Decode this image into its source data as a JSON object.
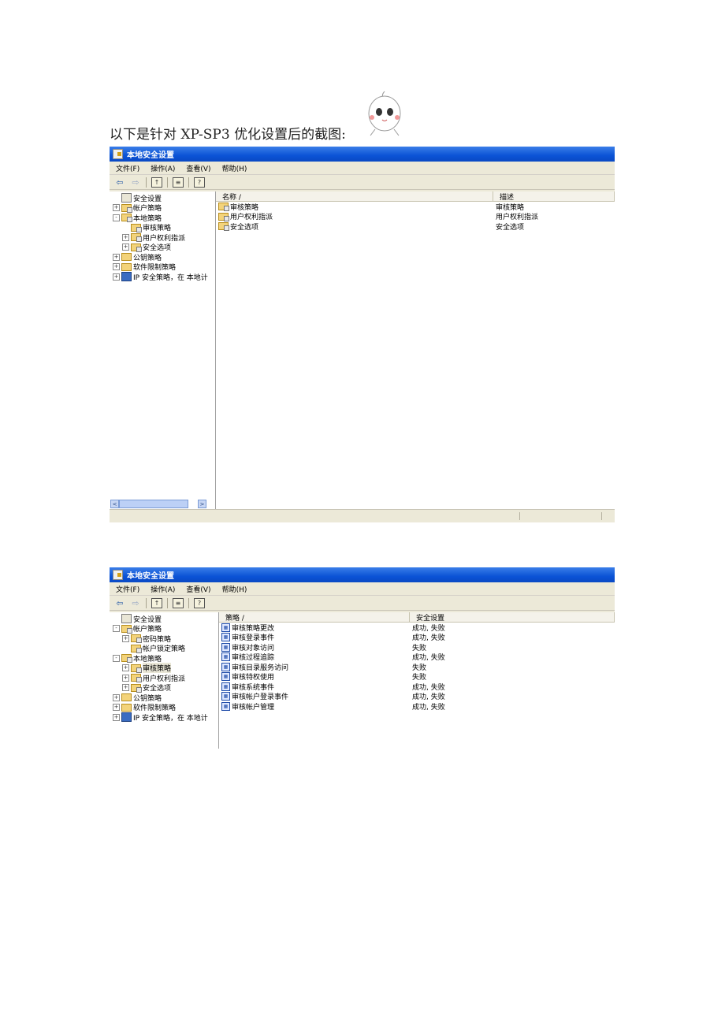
{
  "caption": "以下是针对 XP-SP3 优化设置后的截图:",
  "window": {
    "title": "本地安全设置",
    "menu": [
      "文件(F)",
      "操作(A)",
      "查看(V)",
      "帮助(H)"
    ]
  },
  "screen1": {
    "tree": [
      {
        "label": "安全设置",
        "level": 0,
        "exp": "",
        "icon": "root"
      },
      {
        "label": "帐户策略",
        "level": 0,
        "exp": "+",
        "icon": "folder"
      },
      {
        "label": "本地策略",
        "level": 0,
        "exp": "-",
        "icon": "folder"
      },
      {
        "label": "审核策略",
        "level": 1,
        "exp": "",
        "icon": "folder"
      },
      {
        "label": "用户权利指派",
        "level": 1,
        "exp": "+",
        "icon": "folder"
      },
      {
        "label": "安全选项",
        "level": 1,
        "exp": "+",
        "icon": "folder"
      },
      {
        "label": "公钥策略",
        "level": 0,
        "exp": "+",
        "icon": "plain"
      },
      {
        "label": "软件限制策略",
        "level": 0,
        "exp": "+",
        "icon": "plain"
      },
      {
        "label": "IP 安全策略，在 本地计",
        "level": 0,
        "exp": "+",
        "icon": "ip"
      }
    ],
    "columns": [
      "名称 /",
      "描述"
    ],
    "rows": [
      [
        "审核策略",
        "审核策略"
      ],
      [
        "用户权利指派",
        "用户权利指派"
      ],
      [
        "安全选项",
        "安全选项"
      ]
    ]
  },
  "screen2": {
    "tree": [
      {
        "label": "安全设置",
        "level": 0,
        "exp": "",
        "icon": "root"
      },
      {
        "label": "帐户策略",
        "level": 0,
        "exp": "-",
        "icon": "folder"
      },
      {
        "label": "密码策略",
        "level": 1,
        "exp": "+",
        "icon": "folder"
      },
      {
        "label": "帐户锁定策略",
        "level": 1,
        "exp": "",
        "icon": "folder"
      },
      {
        "label": "本地策略",
        "level": 0,
        "exp": "-",
        "icon": "folder"
      },
      {
        "label": "审核策略",
        "level": 1,
        "exp": "+",
        "icon": "folder",
        "selected": true
      },
      {
        "label": "用户权利指派",
        "level": 1,
        "exp": "+",
        "icon": "folder"
      },
      {
        "label": "安全选项",
        "level": 1,
        "exp": "+",
        "icon": "folder"
      },
      {
        "label": "公钥策略",
        "level": 0,
        "exp": "+",
        "icon": "plain"
      },
      {
        "label": "软件限制策略",
        "level": 0,
        "exp": "+",
        "icon": "plain"
      },
      {
        "label": "IP 安全策略，在 本地计",
        "level": 0,
        "exp": "+",
        "icon": "ip"
      }
    ],
    "columns": [
      "策略 /",
      "安全设置"
    ],
    "rows": [
      [
        "审核策略更改",
        "成功, 失败"
      ],
      [
        "审核登录事件",
        "成功, 失败"
      ],
      [
        "审核对象访问",
        "失败"
      ],
      [
        "审核过程追踪",
        "成功, 失败"
      ],
      [
        "审核目录服务访问",
        "失败"
      ],
      [
        "审核特权使用",
        "失败"
      ],
      [
        "审核系统事件",
        "成功, 失败"
      ],
      [
        "审核帐户登录事件",
        "成功, 失败"
      ],
      [
        "审核帐户管理",
        "成功, 失败"
      ]
    ]
  }
}
